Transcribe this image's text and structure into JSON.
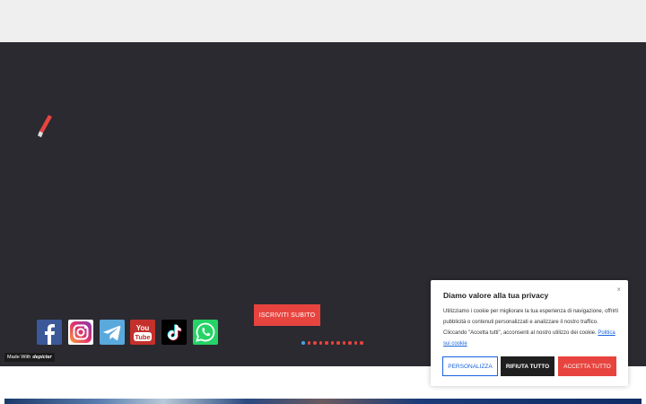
{
  "hero": {
    "cta_label": "ISCRIVITI SUBITO",
    "slider_dot_count": 11,
    "slider_active_index": 0
  },
  "social": [
    {
      "name": "facebook-icon",
      "color": "#3b5998"
    },
    {
      "name": "instagram-icon",
      "color": "#ffffff"
    },
    {
      "name": "telegram-icon",
      "color": "#5aa9dc"
    },
    {
      "name": "youtube-icon",
      "color": "#c4302b"
    },
    {
      "name": "tiktok-icon",
      "color": "#000000"
    },
    {
      "name": "whatsapp-icon",
      "color": "#25d366"
    }
  ],
  "badge": {
    "prefix": "Made With",
    "brand": "depicter"
  },
  "cookie": {
    "title": "Diamo valore alla tua privacy",
    "close": "×",
    "text": "Utilizziamo i cookie per migliorare la tua esperienza di navigazione, offrirti pubblicità o contenuti personalizzati e analizzare il nostro traffico. Cliccando \"Accetta tutti\", acconsenti al nostro utilizzo dei cookie.",
    "policy_link": "Politica sui cookie",
    "customize_label": "PERSONALIZZA",
    "reject_label": "RIFIUTA TUTTO",
    "accept_label": "ACCETTA TUTTO"
  },
  "colors": {
    "accent": "#e8443f",
    "hero_bg": "#2b2a30",
    "link": "#1863dc"
  }
}
